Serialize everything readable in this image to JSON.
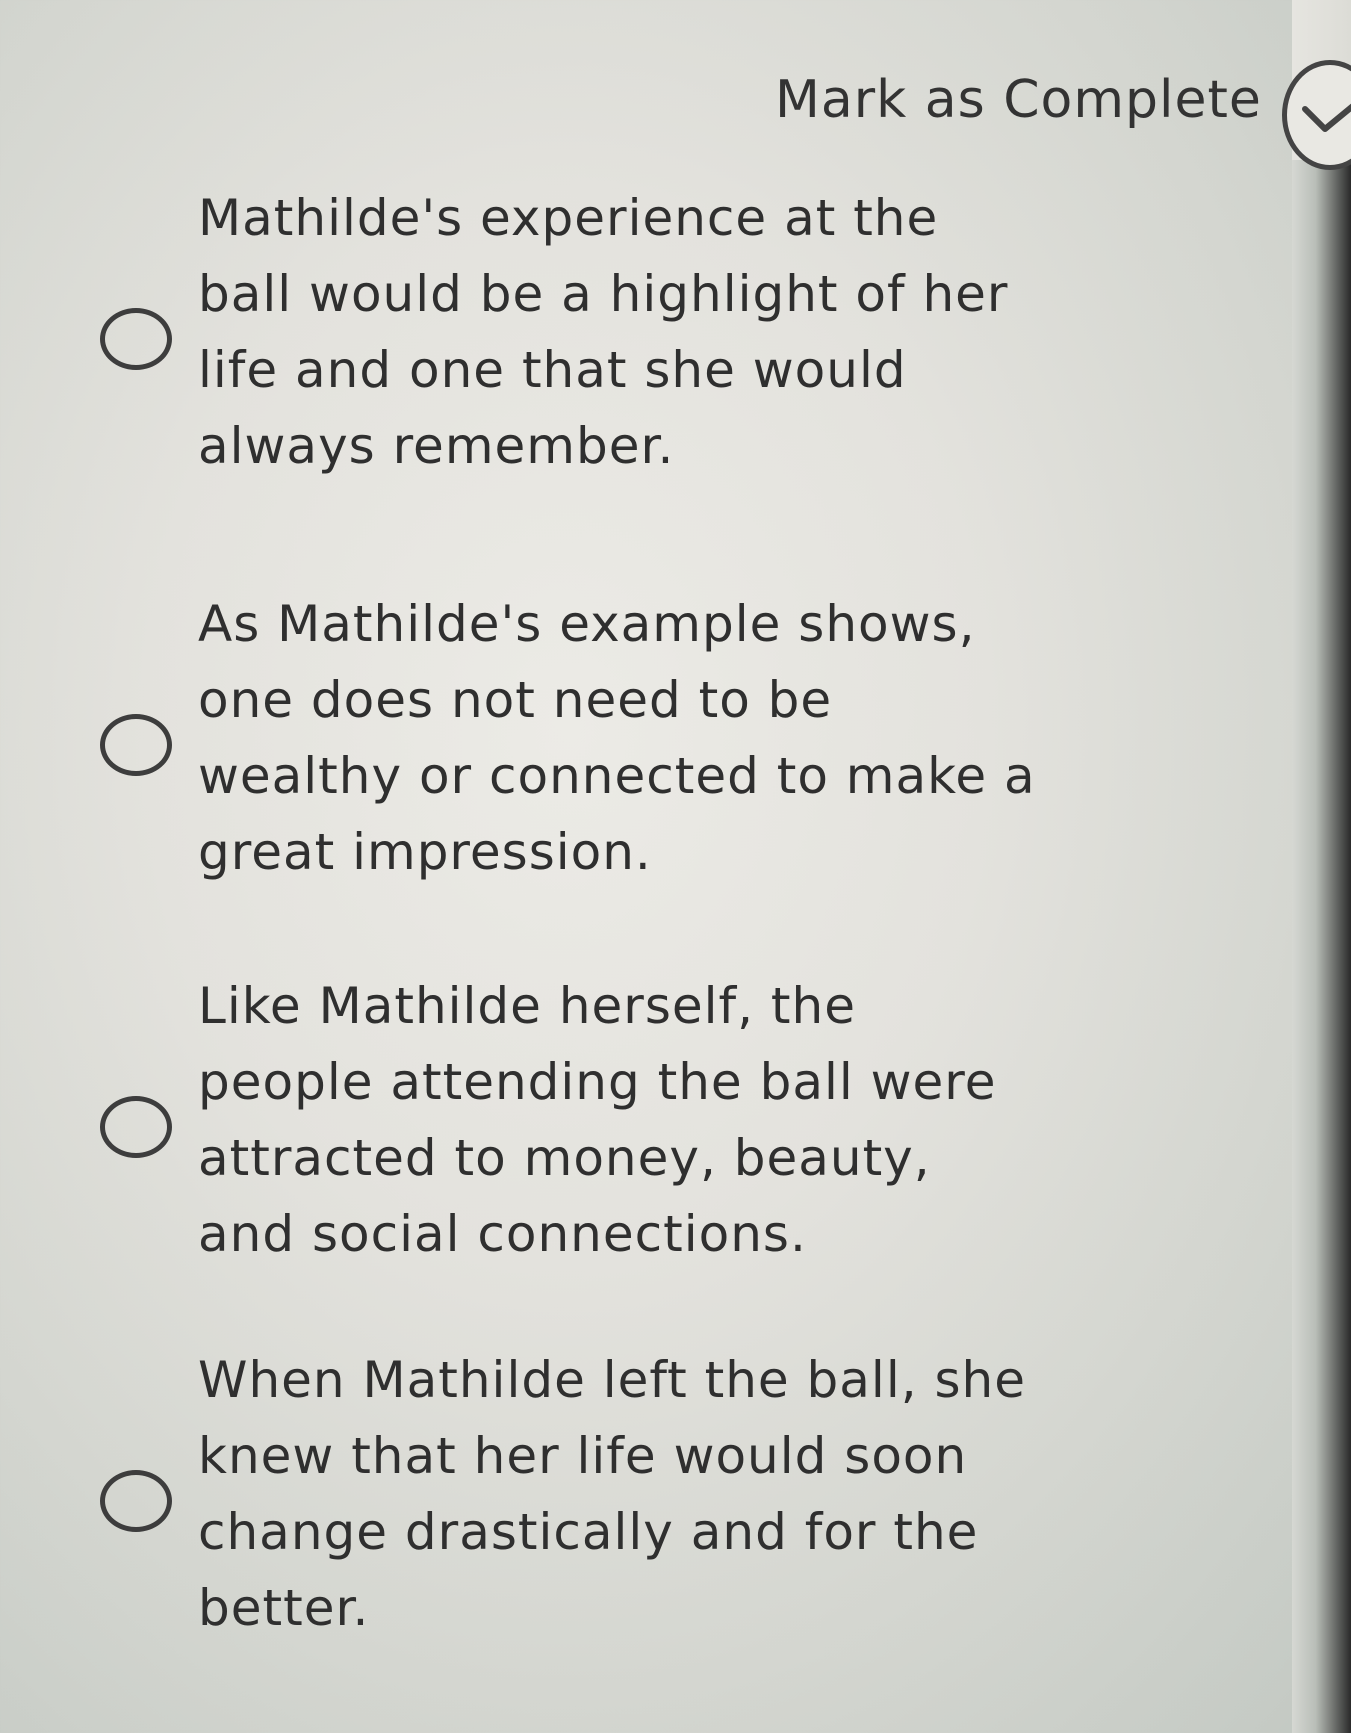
{
  "header": {
    "mark_complete_label": "Mark as Complete",
    "mark_complete_icon": "check-circle-icon"
  },
  "options": [
    {
      "label": "Mathilde's experience at the ball would be a highlight of her life and one that she would always remember.",
      "selected": false
    },
    {
      "label": "As Mathilde's example shows, one does not need to be wealthy or connected to make a great impression.",
      "selected": false
    },
    {
      "label": "Like Mathilde herself, the people attending the ball were attracted to money, beauty, and social connections.",
      "selected": false
    },
    {
      "label": "When Mathilde left the ball, she knew that her life would soon change drastically and for the better.",
      "selected": false
    }
  ]
}
